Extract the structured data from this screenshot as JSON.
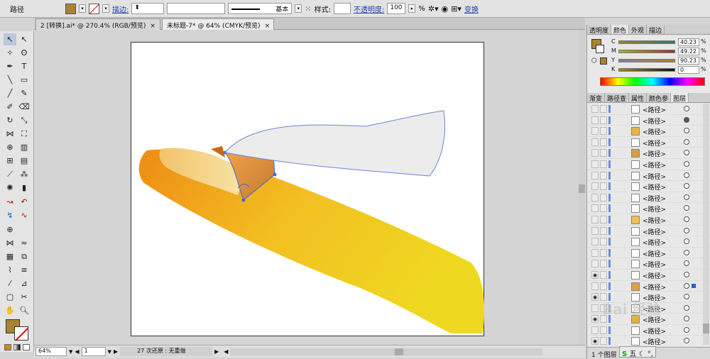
{
  "control_bar": {
    "object_label": "路径",
    "fill_color": "#a8842e",
    "stroke_label": "描边:",
    "style_label": "样式:",
    "opacity_label": "不透明度:",
    "opacity_value": "100",
    "percent": "%",
    "stroke_profile": "基本",
    "transform_label": "变换"
  },
  "doc_tabs": [
    {
      "label": "2 [转换].ai* @ 270.4% (RGB/预览)",
      "close": "×"
    },
    {
      "label": "未标题-7* @ 64% (CMYK/预览)",
      "close": "×"
    }
  ],
  "status_bar": {
    "zoom": "64%",
    "artboard": "1",
    "history": "27 次还原 : 无重做",
    "arrow_left": "◀",
    "arrow_right": "▶",
    "caret": "▼",
    "prev": "◀",
    "next": "▶"
  },
  "color_panel": {
    "tabs": [
      "透明度",
      "颜色",
      "外观",
      "描边"
    ],
    "channels": [
      {
        "name": "C",
        "value": "40.23"
      },
      {
        "name": "M",
        "value": "49.22"
      },
      {
        "name": "Y",
        "value": "90.23"
      },
      {
        "name": "K",
        "value": "0"
      }
    ],
    "percent": "%"
  },
  "layers_panel": {
    "tabs": [
      "渐变",
      "路径查",
      "属性",
      "颜色参",
      "图层"
    ],
    "rows": [
      {
        "name": "<路径>"
      },
      {
        "name": "<路径>"
      },
      {
        "name": "<路径>"
      },
      {
        "name": "<路径>"
      },
      {
        "name": "<路径>"
      },
      {
        "name": "<路径>"
      },
      {
        "name": "<路径>"
      },
      {
        "name": "<路径>"
      },
      {
        "name": "<路径>"
      },
      {
        "name": "<路径>"
      },
      {
        "name": "<路径>"
      },
      {
        "name": "<路径>"
      },
      {
        "name": "<路径>"
      },
      {
        "name": "<路径>"
      },
      {
        "name": "<路径>"
      },
      {
        "name": "<路径>"
      },
      {
        "name": "<路径>"
      },
      {
        "name": "<路径>"
      },
      {
        "name": "<路径>"
      },
      {
        "name": "<路径>"
      },
      {
        "name": "<路径>"
      },
      {
        "name": "<路径>"
      }
    ],
    "footer": "1 个图层"
  },
  "ime": {
    "label": "五"
  },
  "watermark": "Bai 经验"
}
